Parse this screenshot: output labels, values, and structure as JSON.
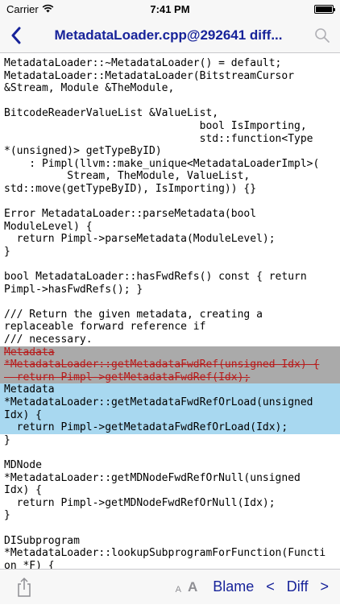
{
  "status_bar": {
    "carrier": "Carrier",
    "time": "7:41 PM",
    "battery_level": 1.0
  },
  "nav": {
    "back_icon": "chevron-left-icon",
    "title": "MetadataLoader.cpp@292641 diff...",
    "search_icon": "search-icon"
  },
  "code": {
    "lines": [
      {
        "text": "MetadataLoader::~MetadataLoader() = default;",
        "type": "normal"
      },
      {
        "text": "MetadataLoader::MetadataLoader(BitstreamCursor",
        "type": "normal"
      },
      {
        "text": "&Stream, Module &TheModule,",
        "type": "normal"
      },
      {
        "text": "",
        "type": "normal"
      },
      {
        "text": "BitcodeReaderValueList &ValueList,",
        "type": "normal"
      },
      {
        "text": "                               bool IsImporting,",
        "type": "normal"
      },
      {
        "text": "                               std::function<Type",
        "type": "normal"
      },
      {
        "text": "*(unsigned)> getTypeByID)",
        "type": "normal"
      },
      {
        "text": "    : Pimpl(llvm::make_unique<MetadataLoaderImpl>(",
        "type": "normal"
      },
      {
        "text": "          Stream, TheModule, ValueList,",
        "type": "normal"
      },
      {
        "text": "std::move(getTypeByID), IsImporting)) {}",
        "type": "normal"
      },
      {
        "text": "",
        "type": "normal"
      },
      {
        "text": "Error MetadataLoader::parseMetadata(bool",
        "type": "normal"
      },
      {
        "text": "ModuleLevel) {",
        "type": "normal"
      },
      {
        "text": "  return Pimpl->parseMetadata(ModuleLevel);",
        "type": "normal"
      },
      {
        "text": "}",
        "type": "normal"
      },
      {
        "text": "",
        "type": "normal"
      },
      {
        "text": "bool MetadataLoader::hasFwdRefs() const { return",
        "type": "normal"
      },
      {
        "text": "Pimpl->hasFwdRefs(); }",
        "type": "normal"
      },
      {
        "text": "",
        "type": "normal"
      },
      {
        "text": "/// Return the given metadata, creating a",
        "type": "normal"
      },
      {
        "text": "replaceable forward reference if",
        "type": "normal"
      },
      {
        "text": "/// necessary.",
        "type": "normal"
      },
      {
        "text": "Metadata",
        "type": "removed"
      },
      {
        "text": "*MetadataLoader::getMetadataFwdRef(unsigned Idx) {",
        "type": "removed"
      },
      {
        "text": "  return Pimpl->getMetadataFwdRef(Idx);",
        "type": "removed"
      },
      {
        "text": "Metadata",
        "type": "added"
      },
      {
        "text": "*MetadataLoader::getMetadataFwdRefOrLoad(unsigned",
        "type": "added"
      },
      {
        "text": "Idx) {",
        "type": "added"
      },
      {
        "text": "  return Pimpl->getMetadataFwdRefOrLoad(Idx);",
        "type": "added"
      },
      {
        "text": "}",
        "type": "normal"
      },
      {
        "text": "",
        "type": "normal"
      },
      {
        "text": "MDNode",
        "type": "normal"
      },
      {
        "text": "*MetadataLoader::getMDNodeFwdRefOrNull(unsigned",
        "type": "normal"
      },
      {
        "text": "Idx) {",
        "type": "normal"
      },
      {
        "text": "  return Pimpl->getMDNodeFwdRefOrNull(Idx);",
        "type": "normal"
      },
      {
        "text": "}",
        "type": "normal"
      },
      {
        "text": "",
        "type": "normal"
      },
      {
        "text": "DISubprogram",
        "type": "normal"
      },
      {
        "text": "*MetadataLoader::lookupSubprogramForFunction(Functi",
        "type": "normal"
      },
      {
        "text": "on *F) {",
        "type": "normal"
      }
    ]
  },
  "toolbar": {
    "share_icon": "share-icon",
    "font_smaller": "A",
    "font_larger": "A",
    "blame_label": "Blame",
    "prev_arrow": "<",
    "diff_label": "Diff",
    "next_arrow": ">"
  },
  "colors": {
    "accent": "#17239a",
    "removed_bg": "#aaaaaa",
    "removed_text": "#b71c1c",
    "added_bg": "#a8d8f0"
  }
}
